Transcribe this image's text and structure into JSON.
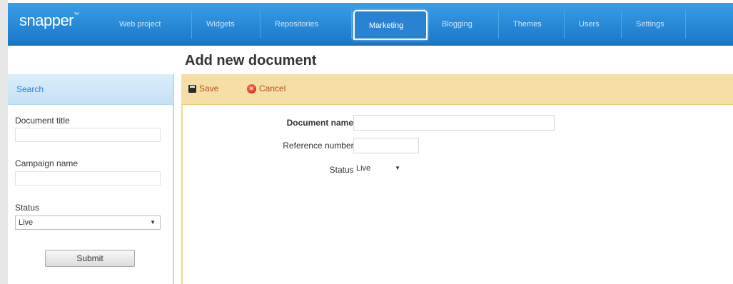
{
  "app": {
    "logo": "snapper",
    "logo_mark": "™"
  },
  "nav": {
    "tabs": [
      {
        "label": "Web project"
      },
      {
        "label": "Widgets"
      },
      {
        "label": "Repositories"
      },
      {
        "label": "Marketing",
        "active": true
      },
      {
        "label": "Blogging"
      },
      {
        "label": "Themes"
      },
      {
        "label": "Users"
      },
      {
        "label": "Settings"
      }
    ]
  },
  "page": {
    "title": "Add new document"
  },
  "toolbar": {
    "save_label": "Save",
    "cancel_label": "Cancel"
  },
  "sidebar": {
    "header": "Search",
    "document_title_label": "Document title",
    "document_title_value": "",
    "campaign_name_label": "Campaign name",
    "campaign_name_value": "",
    "status_label": "Status",
    "status_value": "Live",
    "submit_label": "Submit"
  },
  "form": {
    "document_name_label": "Document name:",
    "document_name_value": "",
    "reference_number_label": "Reference number:",
    "reference_number_value": "",
    "status_label": "Status:",
    "status_value": "Live"
  },
  "colors": {
    "nav_blue": "#1977c9",
    "toolbar_yellow": "#f5dfa6",
    "sidebar_head": "#c5e1f5",
    "cancel_red": "#c4160b"
  }
}
